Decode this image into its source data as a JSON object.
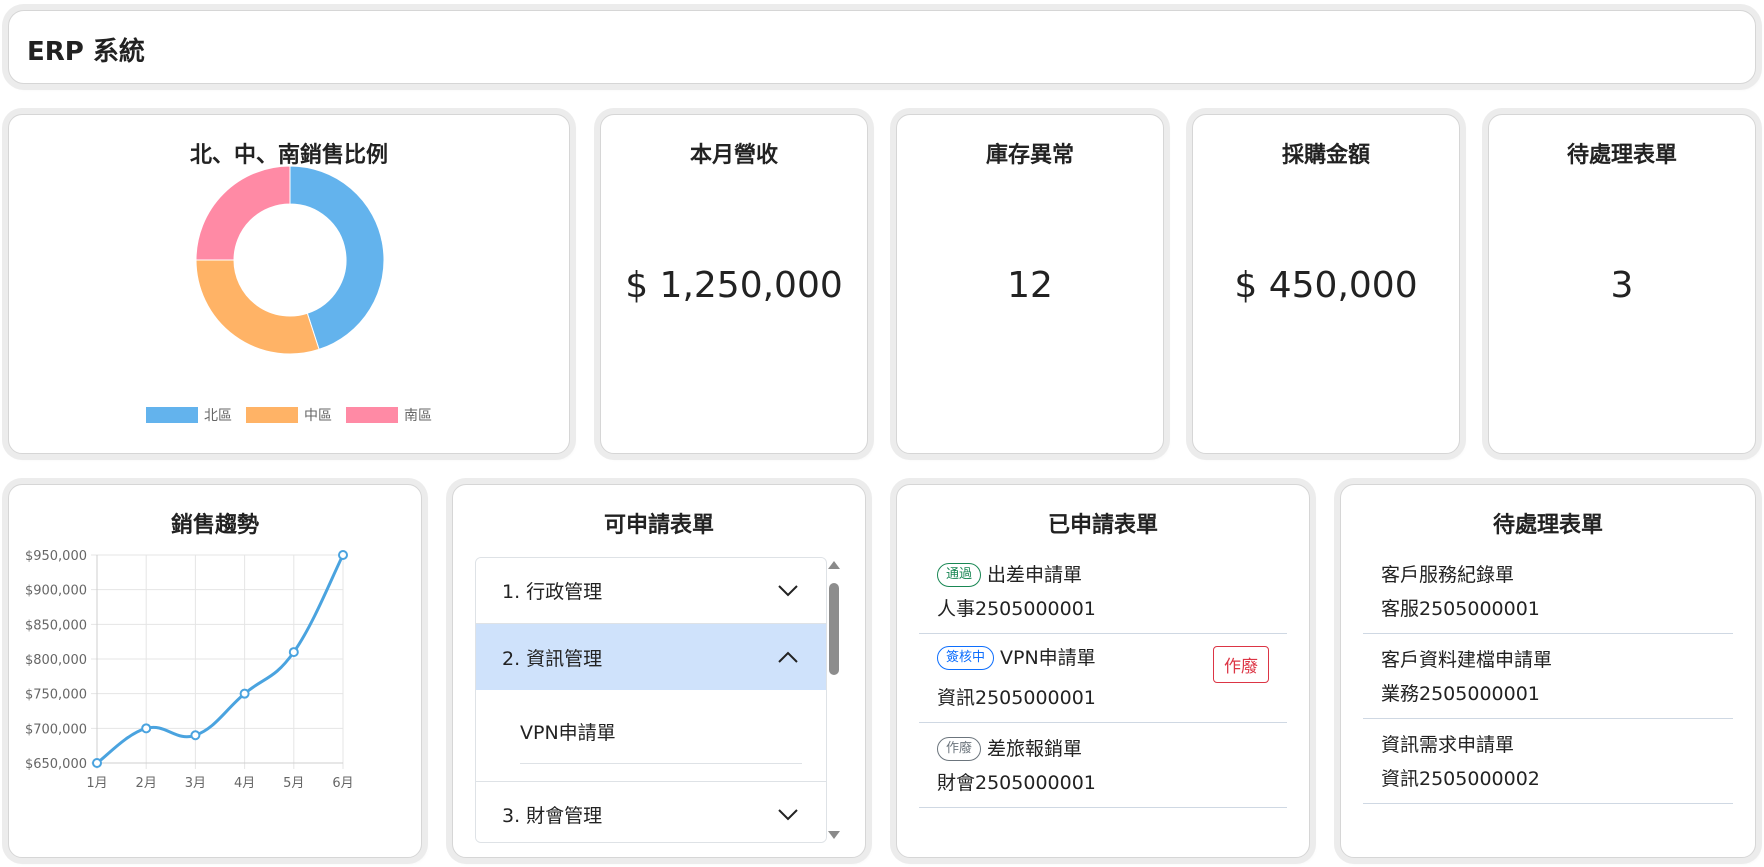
{
  "header": {
    "title": "ERP 系統"
  },
  "sales_ratio": {
    "title": "北、中、南銷售比例",
    "chart_data": {
      "type": "pie",
      "categories": [
        "北區",
        "中區",
        "南區"
      ],
      "values": [
        45,
        30,
        25
      ],
      "colors": [
        "#63b3ed",
        "#ffb366",
        "#ff8aa5"
      ],
      "legend": "bottom"
    }
  },
  "stats": [
    {
      "title": "本月營收",
      "value": "$ 1,250,000"
    },
    {
      "title": "庫存異常",
      "value": "12"
    },
    {
      "title": "採購金額",
      "value": "$ 450,000"
    },
    {
      "title": "待處理表單",
      "value": "3"
    }
  ],
  "sales_trend": {
    "title": "銷售趨勢",
    "chart_data": {
      "type": "line",
      "categories": [
        "1月",
        "2月",
        "3月",
        "4月",
        "5月",
        "6月"
      ],
      "values": [
        650000,
        700000,
        690000,
        750000,
        810000,
        950000
      ],
      "ylim": [
        650000,
        950000
      ],
      "yticks": [
        "$950,000",
        "$900,000",
        "$850,000",
        "$800,000",
        "$750,000",
        "$700,000",
        "$650,000"
      ],
      "color": "#4aa3df",
      "grid": true
    }
  },
  "apply_forms": {
    "title": "可申請表單",
    "items": [
      {
        "label": "1. 行政管理",
        "open": false
      },
      {
        "label": "2. 資訊管理",
        "open": true,
        "children": [
          "VPN申請單"
        ]
      },
      {
        "label": "3. 財會管理",
        "open": false
      }
    ]
  },
  "applied_forms": {
    "title": "已申請表單",
    "items": [
      {
        "status": "通過",
        "name": "出差申請單",
        "number": "人事2505000001"
      },
      {
        "status": "簽核中",
        "name": "VPN申請單",
        "number": "資訊2505000001",
        "action": "作廢"
      },
      {
        "status": "作廢",
        "name": "差旅報銷單",
        "number": "財會2505000001"
      }
    ]
  },
  "pending_forms": {
    "title": "待處理表單",
    "items": [
      {
        "name": "客戶服務紀錄單",
        "number": "客服2505000001"
      },
      {
        "name": "客戶資料建檔申請單",
        "number": "業務2505000001"
      },
      {
        "name": "資訊需求申請單",
        "number": "資訊2505000002"
      }
    ]
  }
}
